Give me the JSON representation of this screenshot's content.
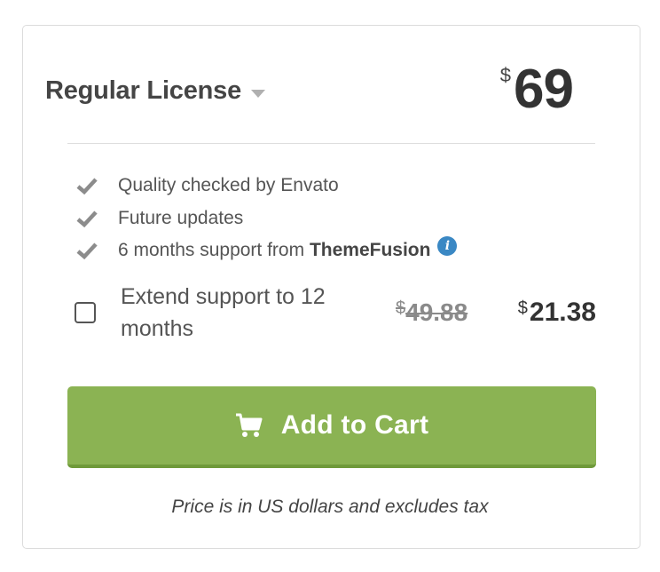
{
  "license": {
    "title": "Regular License",
    "dropdown_icon": "caret-down-icon",
    "price": {
      "currency": "$",
      "amount": "69"
    }
  },
  "features": [
    {
      "icon": "check-icon",
      "text": "Quality checked by Envato",
      "highlight": ""
    },
    {
      "icon": "check-icon",
      "text": "Future updates",
      "highlight": ""
    },
    {
      "icon": "check-icon",
      "text": "6 months support from ",
      "highlight": "ThemeFusion",
      "extra_icon": "info-icon"
    }
  ],
  "extend_support": {
    "label": "Extend support to 12 months",
    "checked": false,
    "old_price": {
      "currency": "$",
      "amount": "49.88"
    },
    "new_price": {
      "currency": "$",
      "amount": "21.38"
    }
  },
  "cart_button": {
    "label": "Add to Cart",
    "icon": "cart-icon",
    "color": "#8bb353"
  },
  "note": "Price is in US dollars and excludes tax",
  "colors": {
    "accent_green": "#8bb353",
    "info_blue": "#3a88c4",
    "check_gray": "#8c8c8c"
  }
}
